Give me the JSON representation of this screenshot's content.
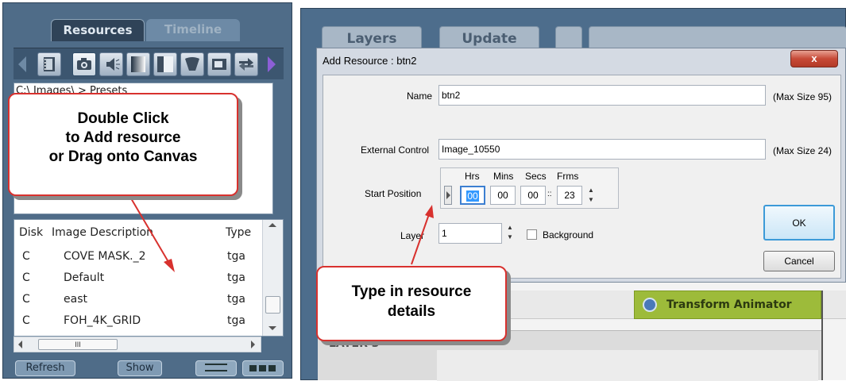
{
  "left_panel": {
    "tabs": [
      "Resources",
      "Timeline"
    ],
    "icons": [
      "film-icon",
      "camera-icon",
      "audio-icon",
      "gradient-icon",
      "mask-icon",
      "screen-icon",
      "swap-icon"
    ],
    "path_text": "C:\\ Images\\ > Presets",
    "table": {
      "headers": [
        "Disk",
        "Image Description",
        "Type"
      ],
      "rows": [
        {
          "disk": "C",
          "desc": "COVE MASK._2",
          "type": "tga"
        },
        {
          "disk": "C",
          "desc": "Default",
          "type": "tga"
        },
        {
          "disk": "C",
          "desc": "east",
          "type": "tga"
        },
        {
          "disk": "C",
          "desc": "FOH_4K_GRID",
          "type": "tga"
        }
      ]
    },
    "hscroll_grip": "III",
    "refresh_label": "Refresh",
    "show_label": "Show"
  },
  "right_area": {
    "tabs": [
      "Layers",
      "Update"
    ],
    "timeline_label": "LAYER 3",
    "animator_label": "Transform Animator"
  },
  "dialog": {
    "title": "Add Resource : btn2",
    "close_label": "x",
    "name_label": "Name",
    "name_value": "btn2",
    "name_max": "(Max Size 95)",
    "ext_label": "External Control",
    "ext_value": "Image_10550",
    "ext_max": "(Max Size 24)",
    "start_label": "Start Position",
    "time_headers": [
      "Hrs",
      "Mins",
      "Secs",
      "Frms"
    ],
    "time_values": [
      "00",
      "00",
      "00",
      "23"
    ],
    "time_sep": "::",
    "layer_label": "Layer",
    "layer_value": "1",
    "background_label": "Background",
    "ok_label": "OK",
    "cancel_label": "Cancel"
  },
  "callouts": {
    "add_resource": [
      "Double Click",
      "to Add resource",
      "or Drag onto Canvas"
    ],
    "details": [
      "Type in resource",
      "details"
    ]
  },
  "colors": {
    "panel_blue": "#4f6c88",
    "callout_border": "#d8312e",
    "animator_green": "#9dbb3a"
  }
}
